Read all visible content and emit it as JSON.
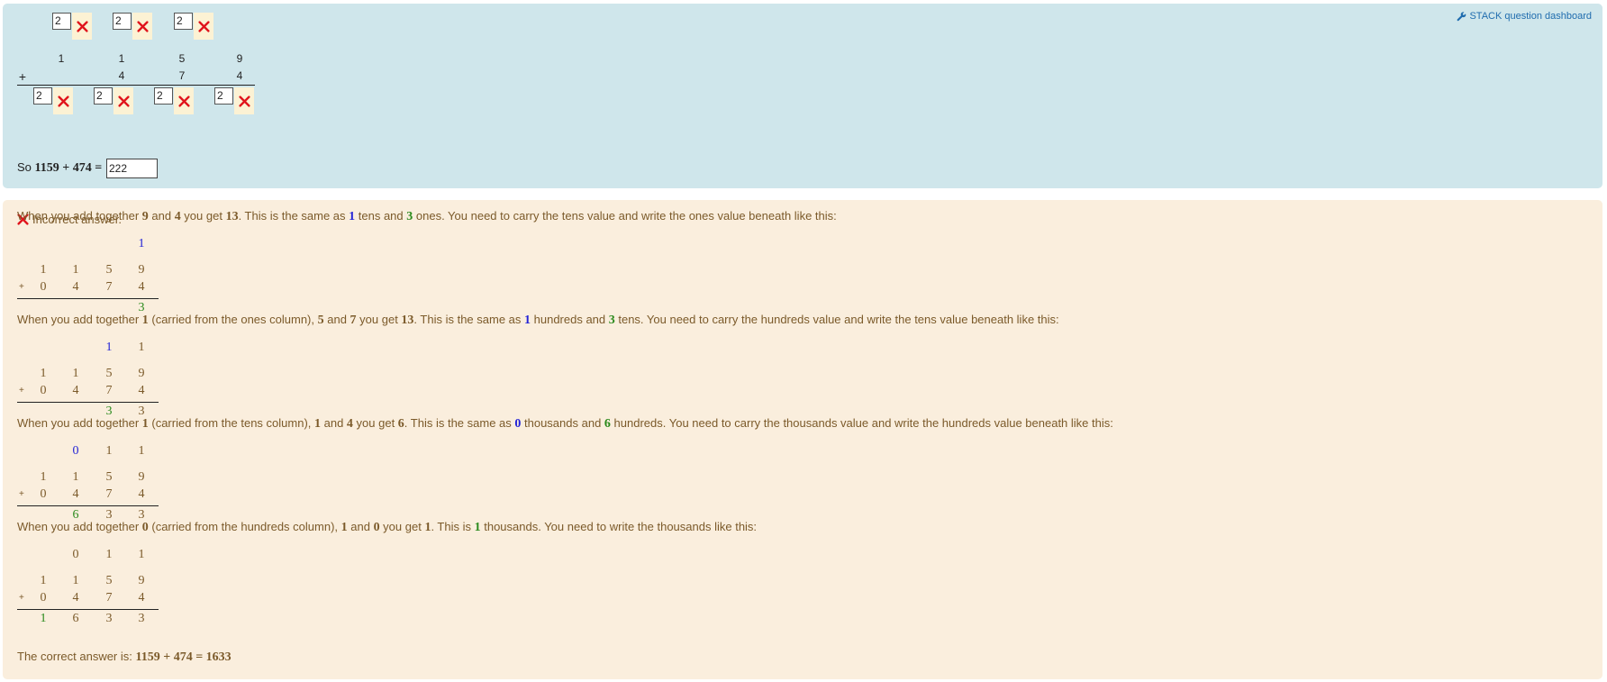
{
  "dashboard": {
    "link_label": "STACK question dashboard",
    "icon": "wrench-icon"
  },
  "question": {
    "carry_inputs": [
      "2",
      "2",
      "2"
    ],
    "top_row": [
      "1",
      "1",
      "5",
      "9"
    ],
    "second_row": [
      "",
      "4",
      "7",
      "4"
    ],
    "plus_sign": "+",
    "result_inputs": [
      "2",
      "2",
      "2",
      "2"
    ],
    "so_text": "So",
    "so_expr": "1159 + 474 =",
    "final_answer": "222"
  },
  "feedback": {
    "status": "Incorrect answer.",
    "steps": [
      {
        "sentence": [
          {
            "t": "When you add together "
          },
          {
            "m": "9",
            "c": "brown"
          },
          {
            "t": " and "
          },
          {
            "m": "4",
            "c": "brown"
          },
          {
            "t": " you get "
          },
          {
            "m": "13",
            "c": "brown"
          },
          {
            "t": ". This is the same as "
          },
          {
            "m": "1",
            "c": "blue"
          },
          {
            "t": " tens and "
          },
          {
            "m": "3",
            "c": "green"
          },
          {
            "t": " ones. You need to carry the tens value and write the ones value beneath like this:"
          }
        ],
        "carry": [
          "",
          "",
          "",
          "1"
        ],
        "carry_colors": [
          "",
          "",
          "",
          "blue"
        ],
        "top": [
          "1",
          "1",
          "5",
          "9"
        ],
        "bottom": [
          "0",
          "4",
          "7",
          "4"
        ],
        "result": [
          "",
          "",
          "",
          "3"
        ],
        "result_colors": [
          "",
          "",
          "",
          "green"
        ]
      },
      {
        "sentence": [
          {
            "t": "When you add together "
          },
          {
            "m": "1",
            "c": "brown"
          },
          {
            "t": " (carried from the ones column), "
          },
          {
            "m": "5",
            "c": "brown"
          },
          {
            "t": " and "
          },
          {
            "m": "7",
            "c": "brown"
          },
          {
            "t": " you get "
          },
          {
            "m": "13",
            "c": "brown"
          },
          {
            "t": ". This is the same as "
          },
          {
            "m": "1",
            "c": "blue"
          },
          {
            "t": " hundreds and "
          },
          {
            "m": "3",
            "c": "green"
          },
          {
            "t": " tens. You need to carry the hundreds value and write the tens value beneath like this:"
          }
        ],
        "carry": [
          "",
          "",
          "1",
          "1"
        ],
        "carry_colors": [
          "",
          "",
          "blue",
          "brown"
        ],
        "top": [
          "1",
          "1",
          "5",
          "9"
        ],
        "bottom": [
          "0",
          "4",
          "7",
          "4"
        ],
        "result": [
          "",
          "",
          "3",
          "3"
        ],
        "result_colors": [
          "",
          "",
          "green",
          "brown"
        ]
      },
      {
        "sentence": [
          {
            "t": "When you add together "
          },
          {
            "m": "1",
            "c": "brown"
          },
          {
            "t": " (carried from the tens column), "
          },
          {
            "m": "1",
            "c": "brown"
          },
          {
            "t": " and "
          },
          {
            "m": "4",
            "c": "brown"
          },
          {
            "t": " you get "
          },
          {
            "m": "6",
            "c": "brown"
          },
          {
            "t": ". This is the same as "
          },
          {
            "m": "0",
            "c": "blue"
          },
          {
            "t": " thousands and "
          },
          {
            "m": "6",
            "c": "green"
          },
          {
            "t": " hundreds. You need to carry the thousands value and write the hundreds value beneath like this:"
          }
        ],
        "carry": [
          "",
          "0",
          "1",
          "1"
        ],
        "carry_colors": [
          "",
          "blue",
          "brown",
          "brown"
        ],
        "top": [
          "1",
          "1",
          "5",
          "9"
        ],
        "bottom": [
          "0",
          "4",
          "7",
          "4"
        ],
        "result": [
          "",
          "6",
          "3",
          "3"
        ],
        "result_colors": [
          "",
          "green",
          "brown",
          "brown"
        ]
      },
      {
        "sentence": [
          {
            "t": "When you add together "
          },
          {
            "m": "0",
            "c": "brown"
          },
          {
            "t": " (carried from the hundreds column), "
          },
          {
            "m": "1",
            "c": "brown"
          },
          {
            "t": " and "
          },
          {
            "m": "0",
            "c": "brown"
          },
          {
            "t": " you get "
          },
          {
            "m": "1",
            "c": "brown"
          },
          {
            "t": ". This is "
          },
          {
            "m": "1",
            "c": "green"
          },
          {
            "t": " thousands. You need to write the thousands like this:"
          }
        ],
        "carry": [
          "",
          "0",
          "1",
          "1"
        ],
        "carry_colors": [
          "",
          "brown",
          "brown",
          "brown"
        ],
        "top": [
          "1",
          "1",
          "5",
          "9"
        ],
        "bottom": [
          "0",
          "4",
          "7",
          "4"
        ],
        "result": [
          "1",
          "6",
          "3",
          "3"
        ],
        "result_colors": [
          "green",
          "brown",
          "brown",
          "brown"
        ]
      }
    ],
    "correct_label": "The correct answer is:",
    "correct_expr": "1159 + 474 = 1633",
    "colors": {
      "blue": "#2424d6",
      "green": "#2b8a1c",
      "brown": "#7b5a2a",
      "cross": "#e0141c"
    }
  }
}
